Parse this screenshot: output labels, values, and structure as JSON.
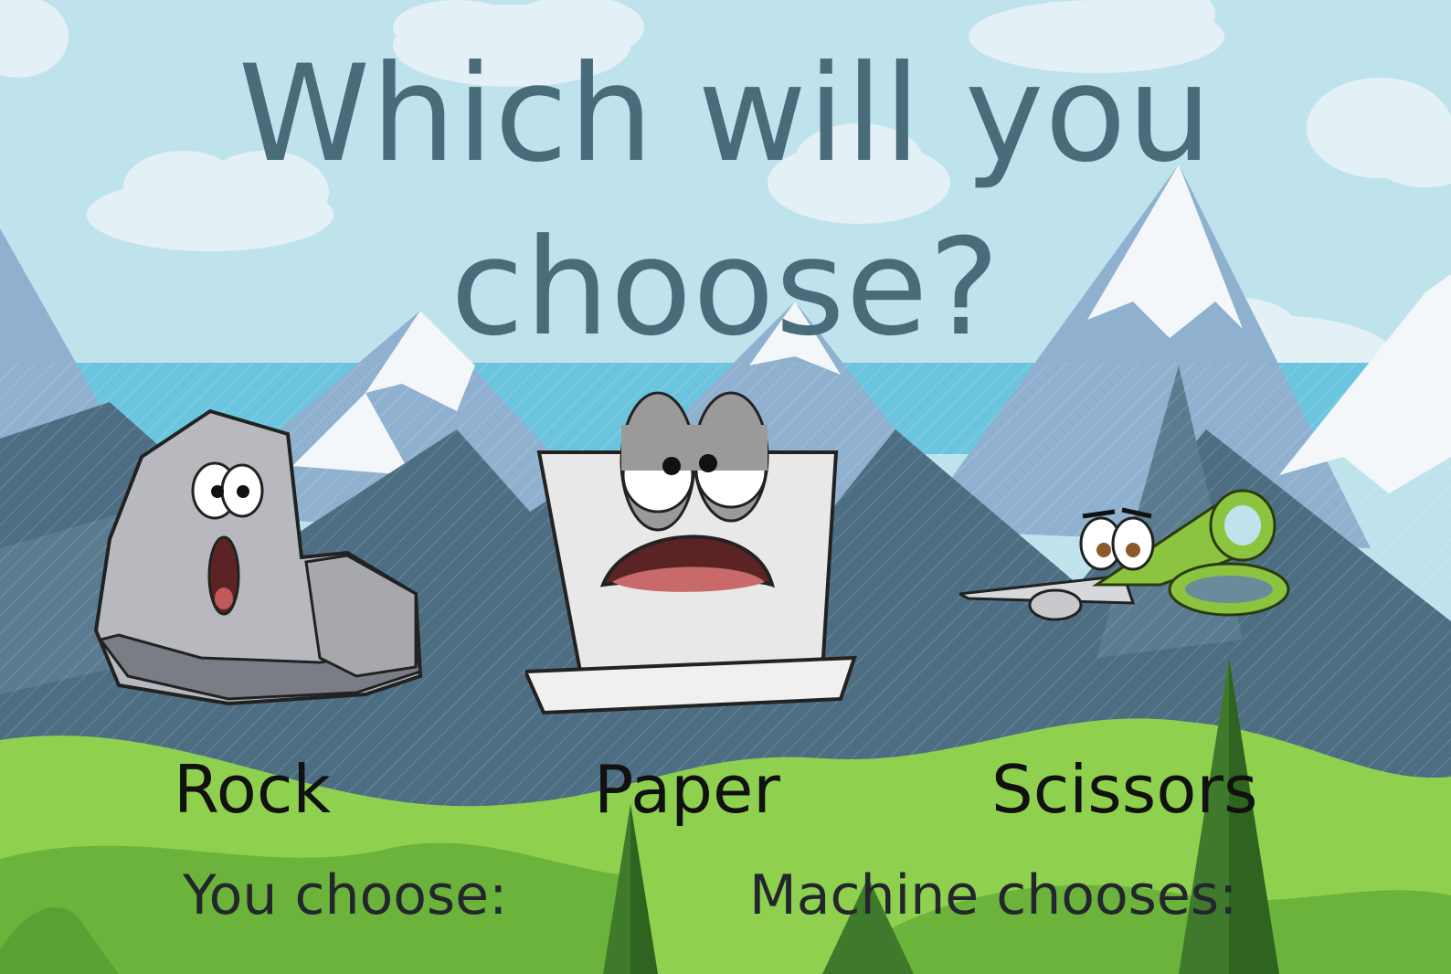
{
  "title": "Which will you choose?",
  "choices": [
    {
      "label": "Rock",
      "icon": "rock-character-icon"
    },
    {
      "label": "Paper",
      "icon": "paper-character-icon"
    },
    {
      "label": "Scissors",
      "icon": "scissors-character-icon"
    }
  ],
  "status": {
    "you_label": "You choose:",
    "machine_label": "Machine chooses:"
  },
  "colors": {
    "sky": "#bfe3ec",
    "title": "#4a6b7a",
    "mountain_dark": "#4d6e82",
    "grass": "#8fd14f"
  }
}
